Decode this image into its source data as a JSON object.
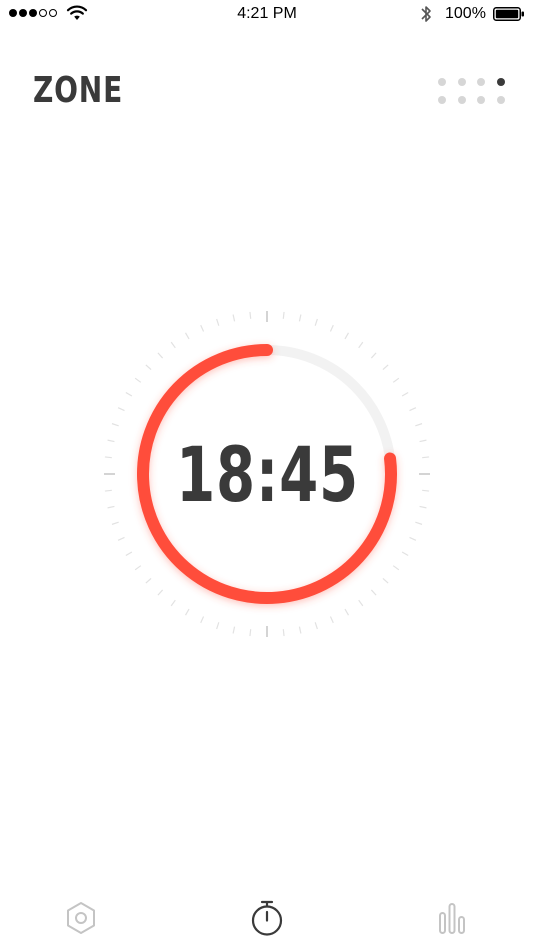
{
  "status_bar": {
    "signal_bars_filled": 3,
    "signal_bars_total": 5,
    "time": "4:21 PM",
    "battery": "100%"
  },
  "header": {
    "title": "ZONE",
    "page_indicator": {
      "total": 8,
      "active_index": 3
    }
  },
  "timer": {
    "display": "18:45",
    "progress": 0.77,
    "accent_color": "#ff4d3a",
    "track_color": "#f2f2f2"
  },
  "bottom_nav": {
    "items": [
      {
        "icon": "hexagon-settings-icon"
      },
      {
        "icon": "stopwatch-icon",
        "active": true
      },
      {
        "icon": "bar-chart-icon"
      }
    ]
  }
}
